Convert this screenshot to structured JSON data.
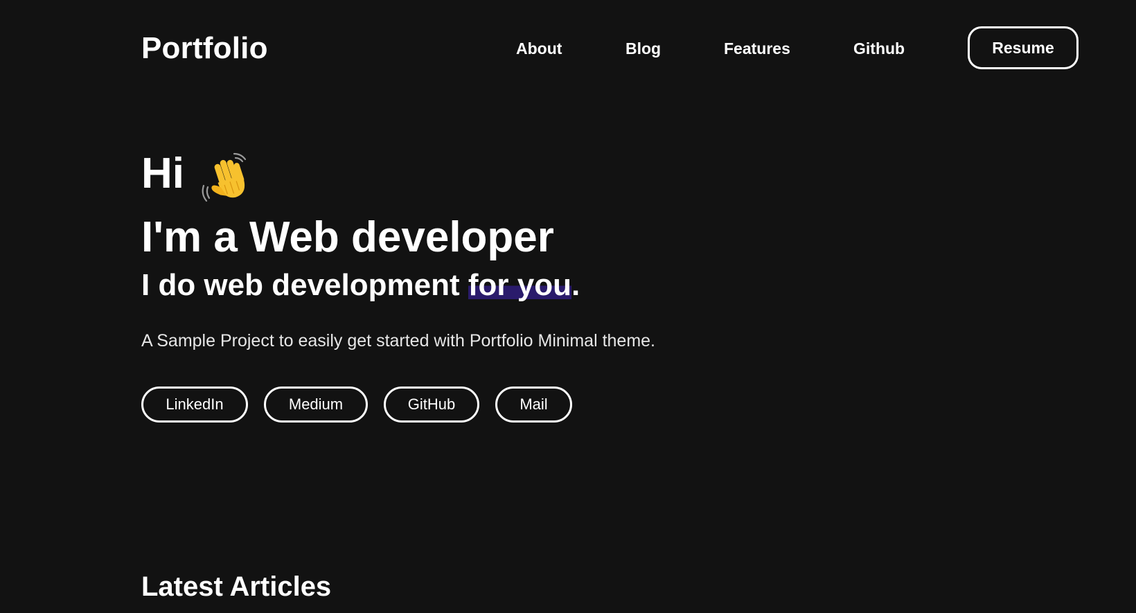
{
  "header": {
    "logo": "Portfolio",
    "nav": {
      "about": "About",
      "blog": "Blog",
      "features": "Features",
      "github": "Github"
    },
    "resume_label": "Resume"
  },
  "hero": {
    "greeting": "Hi",
    "greeting_icon": "waving-hand-icon",
    "headline": "I'm a Web developer",
    "subheadline_prefix": "I do web development ",
    "subheadline_highlight": "for you",
    "subheadline_suffix": ".",
    "description": "A Sample Project to easily get started with Portfolio Minimal theme.",
    "social_links": [
      "LinkedIn",
      "Medium",
      "GitHub",
      "Mail"
    ]
  },
  "articles": {
    "title": "Latest Articles"
  },
  "colors": {
    "background": "#121212",
    "text": "#ffffff",
    "highlight": "#2a1b6b",
    "wave_icon": "#f7c12e"
  }
}
